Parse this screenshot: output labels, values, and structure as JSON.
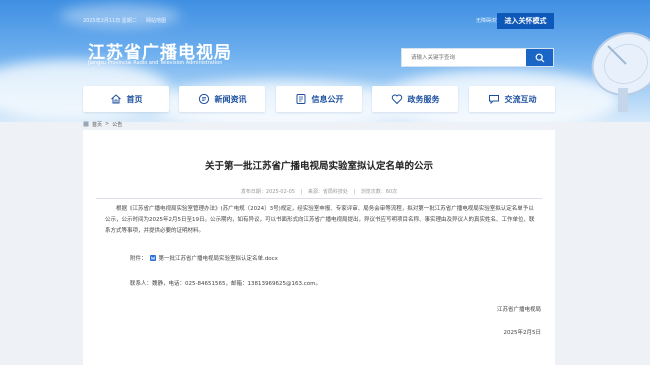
{
  "topbar": {
    "date": "2025年2月11日 星期二",
    "sitemap": "网站地图",
    "accessible": "无障碍浏览",
    "care_mode": "进入关怀模式"
  },
  "header": {
    "logo_cn": "江苏省广播电视局",
    "logo_en": "Jiangsu Provincial Radio and Television Administration"
  },
  "search": {
    "placeholder": "请输入关键字查询"
  },
  "nav": {
    "items": [
      {
        "label": "首页",
        "icon": "home-icon"
      },
      {
        "label": "新闻资讯",
        "icon": "news-icon"
      },
      {
        "label": "信息公开",
        "icon": "info-icon"
      },
      {
        "label": "政务服务",
        "icon": "service-icon"
      },
      {
        "label": "交流互动",
        "icon": "chat-icon"
      }
    ]
  },
  "breadcrumb": {
    "home": "首页",
    "current": "公告"
  },
  "article": {
    "title": "关于第一批江苏省广播电视局实验室拟认定名单的公示",
    "publish_time": "发布日期：2025-02-05",
    "source": "来源：省局科技处",
    "views": "浏览次数：60次",
    "body": "根据《江苏省广播电视局实验室管理办法》(苏广电规〔2024〕3号)规定，经实验室申报、专家评审、局务会审等流程，拟对第一批江苏省广播电视局实验室拟认定名单予以公示，公示时间为2025年2月5日至19日。公示期内，如有异议，可以书面形式向江苏省广播电视局提出，异议书应写明项目名称、事实理由及异议人的真实姓名、工作单位、联系方式等事项，并提供必要的证明材料。",
    "attachment_label": "附件：",
    "attachment_file": "第一批江苏省广播电视局实验室拟认定名单.docx",
    "contact": "联系人：魏静，电话：025-84651565，邮箱：13813969625@163.com。",
    "signature": "江苏省广播电视局",
    "sign_date": "2025年2月5日"
  },
  "colors": {
    "nav_text": "#1b4f9e",
    "care_button": "#0d58b8",
    "search_button": "#1a66c6"
  }
}
